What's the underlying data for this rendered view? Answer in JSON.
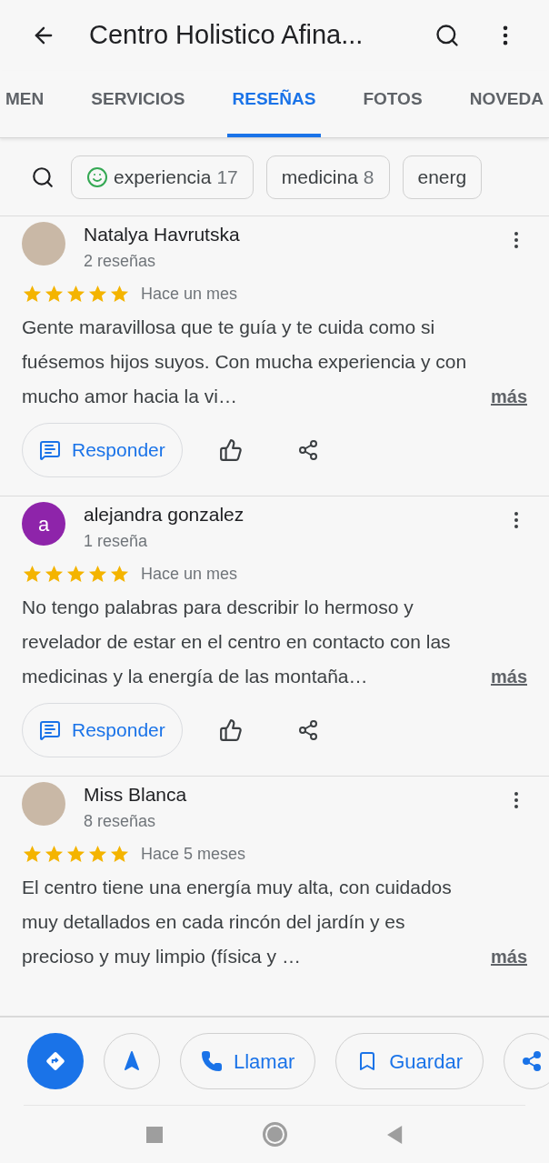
{
  "header": {
    "title": "Centro Holistico Afina..."
  },
  "tabs": [
    {
      "label": "MEN",
      "selected": false
    },
    {
      "label": "SERVICIOS",
      "selected": false
    },
    {
      "label": "RESEÑAS",
      "selected": true
    },
    {
      "label": "FOTOS",
      "selected": false
    },
    {
      "label": "NOVEDA",
      "selected": false
    }
  ],
  "topic_chips": [
    {
      "label": "experiencia",
      "count": "17",
      "kind": "sentiment"
    },
    {
      "label": "medicina",
      "count": "8",
      "kind": "plain"
    },
    {
      "label": "energ",
      "kind": "plain"
    }
  ],
  "reviews": [
    {
      "author": "Natalya Havrutska",
      "count": "2 reseñas",
      "avatar": {
        "kind": "photo"
      },
      "stars": 5,
      "time": "Hace un mes",
      "text": "Gente maravillosa que te guía y te cuida como si fuésemos hijos suyos. Con mucha experiencia y con mucho amor hacia la vi…",
      "more": "más",
      "reply": "Responder"
    },
    {
      "author": "alejandra gonzalez",
      "count": "1 reseña",
      "avatar": {
        "kind": "letter",
        "letter": "a",
        "color": "#8e24aa"
      },
      "stars": 5,
      "time": "Hace un mes",
      "text": "No tengo palabras para describir lo hermoso y revelador de estar en el centro en contacto con las medicinas y la energía de las montaña…",
      "more": "más",
      "reply": "Responder"
    },
    {
      "author": "Miss Blanca",
      "count": "8 reseñas",
      "avatar": {
        "kind": "photo"
      },
      "stars": 5,
      "time": "Hace 5 meses",
      "text": "El centro tiene una energía muy alta, con cuidados muy detallados en cada rincón del jardín y es precioso y muy limpio (física y …",
      "more": "más"
    }
  ],
  "actions": [
    {
      "kind": "directions"
    },
    {
      "kind": "start"
    },
    {
      "kind": "call",
      "label": "Llamar"
    },
    {
      "kind": "save",
      "label": "Guardar"
    },
    {
      "kind": "share"
    }
  ]
}
